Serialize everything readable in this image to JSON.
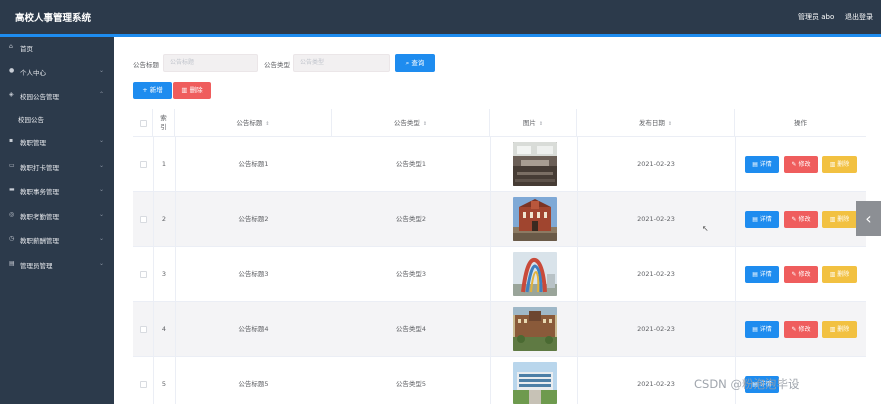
{
  "app": {
    "title": "高校人事管理系统",
    "user_label": "管理员 abo",
    "logout_label": "退出登录"
  },
  "sidebar": {
    "items": [
      {
        "label": "首页",
        "icon": "home-icon",
        "expandable": false
      },
      {
        "label": "个人中心",
        "icon": "user-icon",
        "expandable": true
      },
      {
        "label": "校园公告管理",
        "icon": "bell-icon",
        "expandable": true
      },
      {
        "label": "校园公告",
        "icon": "",
        "expandable": false,
        "sub": true
      },
      {
        "label": "教职管理",
        "icon": "briefcase-icon",
        "expandable": true
      },
      {
        "label": "教职打卡管理",
        "icon": "calendar-icon",
        "expandable": true
      },
      {
        "label": "教职事务管理",
        "icon": "folder-icon",
        "expandable": true
      },
      {
        "label": "教职考勤管理",
        "icon": "clock-icon",
        "expandable": true
      },
      {
        "label": "教职薪酬管理",
        "icon": "money-icon",
        "expandable": true
      },
      {
        "label": "管理员管理",
        "icon": "admin-icon",
        "expandable": true
      }
    ]
  },
  "filters": {
    "title_label": "公告标题",
    "title_placeholder": "公告标题",
    "type_label": "公告类型",
    "type_placeholder": "公告类型",
    "search_label": "查询"
  },
  "toolbar": {
    "add_label": "新增",
    "delete_label": "删除"
  },
  "table": {
    "columns": [
      "索引",
      "公告标题",
      "公告类型",
      "图片",
      "发布日期",
      "操作"
    ],
    "rows": [
      {
        "index": "1",
        "title": "公告标题1",
        "type": "公告类型1",
        "date": "2021-02-23",
        "photo": "lecture-hall-photo"
      },
      {
        "index": "2",
        "title": "公告标题2",
        "type": "公告类型2",
        "date": "2021-02-23",
        "photo": "brick-building-photo"
      },
      {
        "index": "3",
        "title": "公告标题3",
        "type": "公告类型3",
        "date": "2021-02-23",
        "photo": "sculpture-photo"
      },
      {
        "index": "4",
        "title": "公告标题4",
        "type": "公告类型4",
        "date": "2021-02-23",
        "photo": "campus-building-photo"
      },
      {
        "index": "5",
        "title": "公告标题5",
        "type": "公告类型5",
        "date": "2021-02-23",
        "photo": "modern-campus-photo"
      }
    ],
    "actions": {
      "detail": "详情",
      "edit": "修改",
      "delete": "删除"
    }
  },
  "watermark": "CSDN @粉泡泡毕设",
  "colors": {
    "header_bg": "#2c3a4b",
    "accent": "#1e8cef",
    "danger": "#ef5d5d",
    "warning": "#f2c141"
  }
}
